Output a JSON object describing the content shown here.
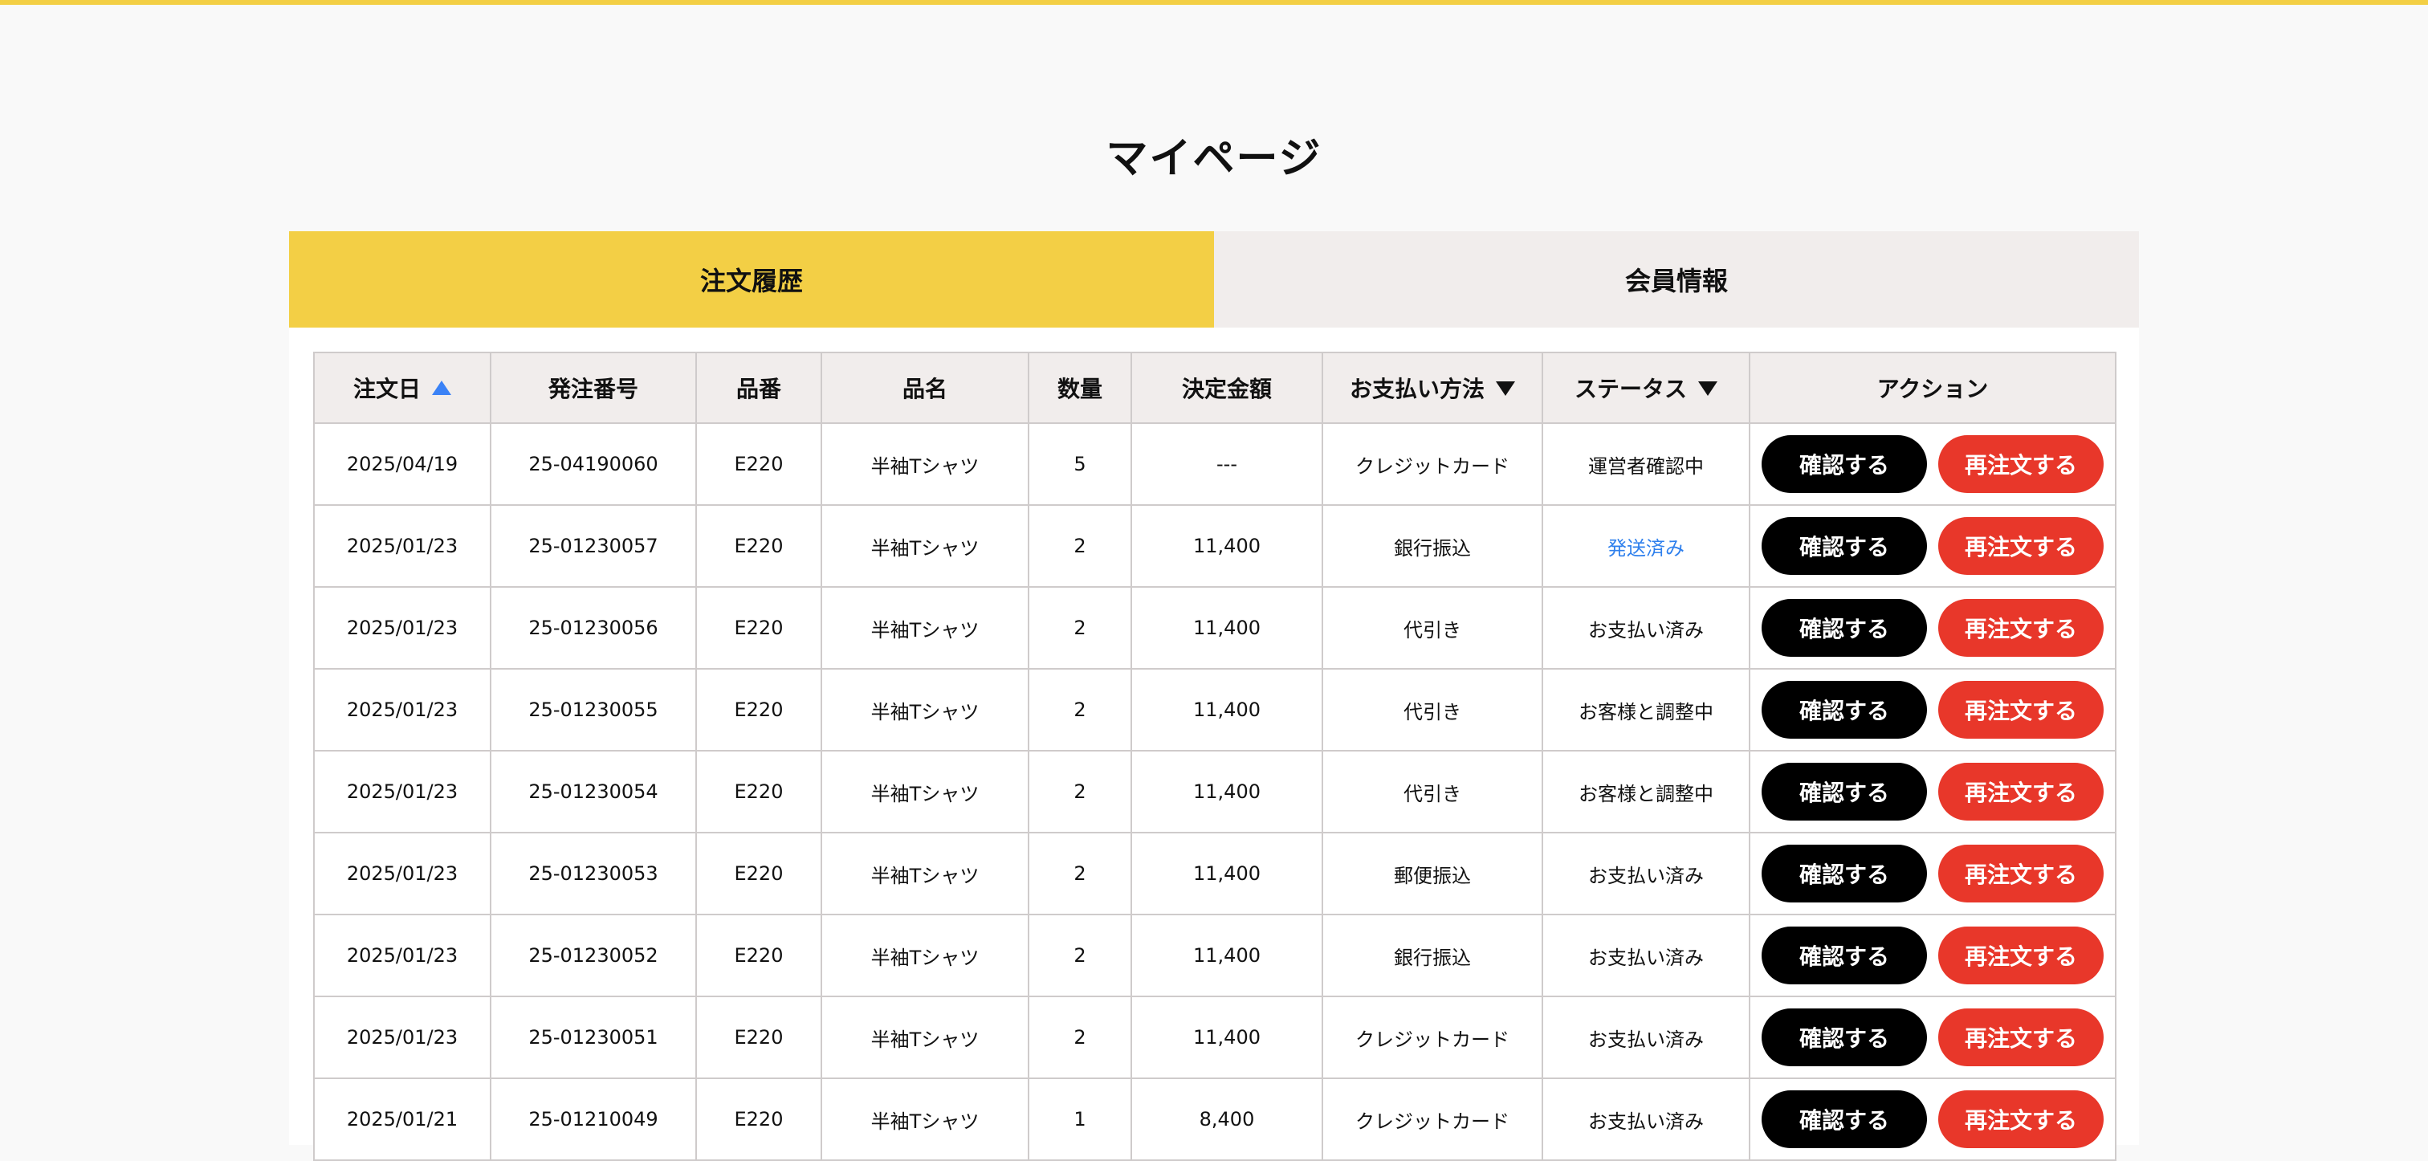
{
  "page": {
    "title": "マイページ"
  },
  "tabs": [
    {
      "label": "注文履歴",
      "active": true
    },
    {
      "label": "会員情報",
      "active": false
    }
  ],
  "table": {
    "headers": {
      "order_date": "注文日",
      "order_number": "発注番号",
      "item_code": "品番",
      "item_name": "品名",
      "quantity": "数量",
      "amount": "決定金額",
      "payment": "お支払い方法",
      "status": "ステータス",
      "action": "アクション"
    },
    "rows": [
      {
        "date": "2025/04/19",
        "order": "25-04190060",
        "code": "E220",
        "name": "半袖Tシャツ",
        "qty": "5",
        "amount": "---",
        "payment": "クレジットカード",
        "status": "運営者確認中"
      },
      {
        "date": "2025/01/23",
        "order": "25-01230057",
        "code": "E220",
        "name": "半袖Tシャツ",
        "qty": "2",
        "amount": "11,400",
        "payment": "銀行振込",
        "status": "発送済み"
      },
      {
        "date": "2025/01/23",
        "order": "25-01230056",
        "code": "E220",
        "name": "半袖Tシャツ",
        "qty": "2",
        "amount": "11,400",
        "payment": "代引き",
        "status": "お支払い済み"
      },
      {
        "date": "2025/01/23",
        "order": "25-01230055",
        "code": "E220",
        "name": "半袖Tシャツ",
        "qty": "2",
        "amount": "11,400",
        "payment": "代引き",
        "status": "お客様と調整中"
      },
      {
        "date": "2025/01/23",
        "order": "25-01230054",
        "code": "E220",
        "name": "半袖Tシャツ",
        "qty": "2",
        "amount": "11,400",
        "payment": "代引き",
        "status": "お客様と調整中"
      },
      {
        "date": "2025/01/23",
        "order": "25-01230053",
        "code": "E220",
        "name": "半袖Tシャツ",
        "qty": "2",
        "amount": "11,400",
        "payment": "郵便振込",
        "status": "お支払い済み"
      },
      {
        "date": "2025/01/23",
        "order": "25-01230052",
        "code": "E220",
        "name": "半袖Tシャツ",
        "qty": "2",
        "amount": "11,400",
        "payment": "銀行振込",
        "status": "お支払い済み"
      },
      {
        "date": "2025/01/23",
        "order": "25-01230051",
        "code": "E220",
        "name": "半袖Tシャツ",
        "qty": "2",
        "amount": "11,400",
        "payment": "クレジットカード",
        "status": "お支払い済み"
      },
      {
        "date": "2025/01/21",
        "order": "25-01210049",
        "code": "E220",
        "name": "半袖Tシャツ",
        "qty": "1",
        "amount": "8,400",
        "payment": "クレジットカード",
        "status": "お支払い済み"
      }
    ],
    "actions": {
      "confirm_label": "確認する",
      "reorder_label": "再注文する"
    }
  },
  "colors": {
    "accent_yellow": "#f3cf45",
    "tab_inactive": "#f1edec",
    "reorder_red": "#e8372a",
    "confirm_black": "#000000",
    "link_blue": "#2f80ed",
    "sort_active_blue": "#3b82f6"
  },
  "icons": {
    "order_date_sort": "sort-ascending-icon",
    "payment_filter": "caret-down-icon",
    "status_filter": "caret-down-icon"
  }
}
